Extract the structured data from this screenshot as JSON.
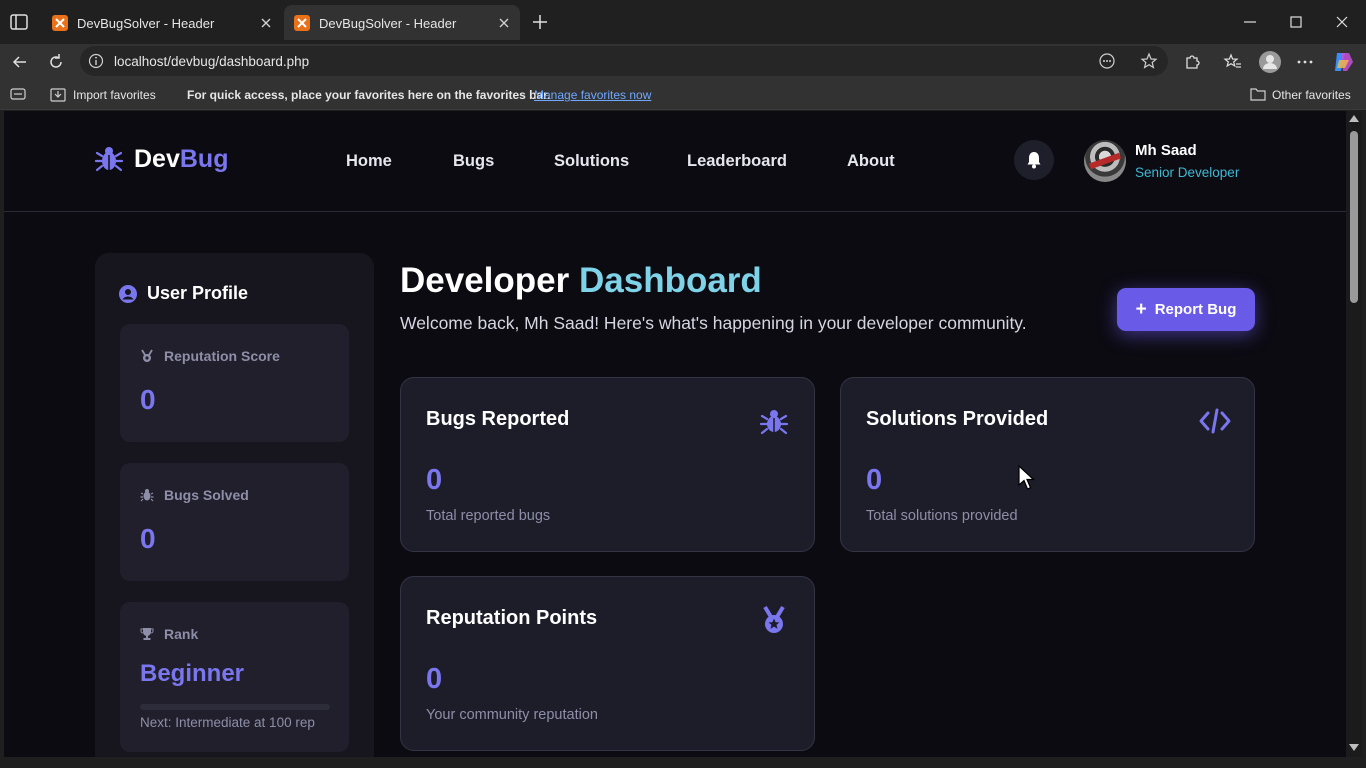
{
  "browser": {
    "tabs": [
      {
        "title": "DevBugSolver - Header",
        "active": false
      },
      {
        "title": "DevBugSolver - Header",
        "active": true
      }
    ],
    "url": "localhost/devbug/dashboard.php",
    "favorites_bar": {
      "import_label": "Import favorites",
      "hint": "For quick access, place your favorites here on the favorites bar.",
      "manage_link": "Manage favorites now",
      "other_label": "Other favorites"
    }
  },
  "site": {
    "logo": {
      "part1": "Dev",
      "part2": "Bug"
    },
    "nav": [
      "Home",
      "Bugs",
      "Solutions",
      "Leaderboard",
      "About"
    ],
    "user": {
      "name": "Mh Saad",
      "role": "Senior Developer"
    },
    "accent_color": "#7a76ee",
    "teal_color": "#7fd3e8"
  },
  "sidebar": {
    "title": "User Profile",
    "reputation": {
      "label": "Reputation Score",
      "value": "0"
    },
    "bugs_solved": {
      "label": "Bugs Solved",
      "value": "0"
    },
    "rank": {
      "label": "Rank",
      "value": "Beginner",
      "next": "Next: Intermediate at 100 rep",
      "progress": 0
    }
  },
  "main": {
    "heading_part1": "Developer",
    "heading_part2": "Dashboard",
    "welcome": "Welcome back, Mh Saad! Here's what's happening in your developer community.",
    "report_button": "Report Bug",
    "cards": [
      {
        "title": "Bugs Reported",
        "value": "0",
        "subtitle": "Total reported bugs",
        "icon": "bug-icon"
      },
      {
        "title": "Solutions Provided",
        "value": "0",
        "subtitle": "Total solutions provided",
        "icon": "code-icon"
      },
      {
        "title": "Reputation Points",
        "value": "0",
        "subtitle": "Your community reputation",
        "icon": "medal-icon"
      }
    ]
  }
}
